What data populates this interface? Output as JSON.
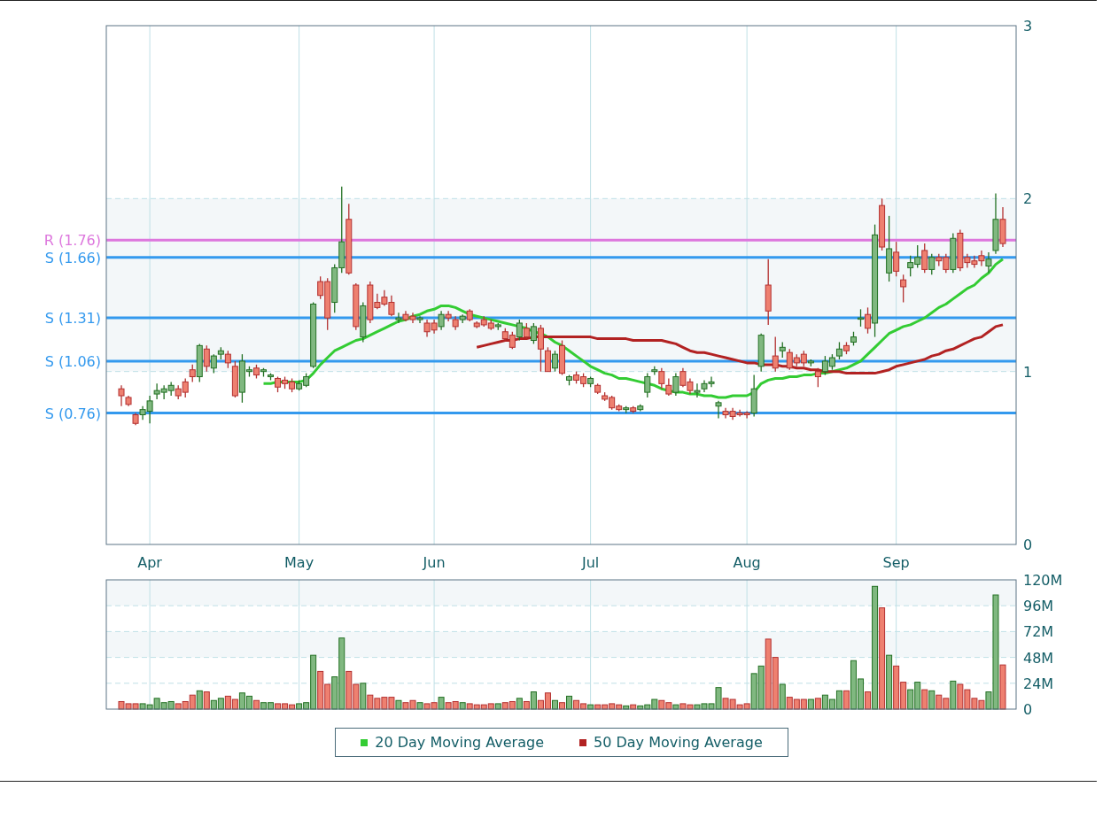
{
  "price_chart": {
    "chart_data": {
      "type": "candlestick",
      "ylim": [
        0,
        3
      ],
      "yticks": [
        0,
        1,
        2,
        3
      ],
      "grid": true,
      "categories": [
        null,
        null,
        null,
        null,
        "Apr",
        null,
        null,
        null,
        null,
        null,
        null,
        null,
        null,
        null,
        null,
        null,
        null,
        null,
        null,
        null,
        null,
        null,
        null,
        null,
        null,
        "May",
        null,
        null,
        null,
        null,
        null,
        null,
        null,
        null,
        null,
        null,
        null,
        null,
        null,
        null,
        null,
        null,
        null,
        null,
        "Jun",
        null,
        null,
        null,
        null,
        null,
        null,
        null,
        null,
        null,
        null,
        null,
        null,
        null,
        null,
        null,
        null,
        null,
        null,
        null,
        null,
        null,
        "Jul",
        null,
        null,
        null,
        null,
        null,
        null,
        null,
        null,
        null,
        null,
        null,
        null,
        null,
        null,
        null,
        null,
        null,
        null,
        null,
        null,
        null,
        "Aug",
        null,
        null,
        null,
        null,
        null,
        null,
        null,
        null,
        null,
        null,
        null,
        null,
        null,
        null,
        null,
        null,
        null,
        null,
        null,
        null,
        "Sep",
        null,
        null,
        null,
        null,
        null,
        null,
        null,
        null,
        null,
        null,
        null,
        null,
        null,
        null,
        null
      ],
      "ohlc": [
        [
          0.9,
          0.92,
          0.8,
          0.86
        ],
        [
          0.85,
          0.86,
          0.8,
          0.81
        ],
        [
          0.75,
          0.76,
          0.69,
          0.7
        ],
        [
          0.75,
          0.8,
          0.72,
          0.78
        ],
        [
          0.77,
          0.86,
          0.7,
          0.83
        ],
        [
          0.87,
          0.93,
          0.84,
          0.89
        ],
        [
          0.88,
          0.92,
          0.84,
          0.9
        ],
        [
          0.89,
          0.94,
          0.86,
          0.92
        ],
        [
          0.9,
          0.92,
          0.84,
          0.86
        ],
        [
          0.94,
          0.96,
          0.85,
          0.88
        ],
        [
          1.01,
          1.04,
          0.94,
          0.97
        ],
        [
          0.97,
          1.16,
          0.94,
          1.15
        ],
        [
          1.13,
          1.15,
          1.0,
          1.03
        ],
        [
          1.02,
          1.1,
          0.99,
          1.09
        ],
        [
          1.1,
          1.14,
          1.07,
          1.12
        ],
        [
          1.1,
          1.12,
          1.02,
          1.05
        ],
        [
          1.03,
          1.06,
          0.85,
          0.86
        ],
        [
          0.88,
          1.1,
          0.82,
          1.06
        ],
        [
          1.0,
          1.03,
          0.97,
          1.01
        ],
        [
          1.02,
          1.04,
          0.96,
          0.98
        ],
        [
          1.0,
          1.02,
          0.97,
          1.01
        ],
        [
          0.97,
          0.99,
          0.95,
          0.98
        ],
        [
          0.96,
          0.97,
          0.88,
          0.91
        ],
        [
          0.95,
          0.97,
          0.9,
          0.93
        ],
        [
          0.94,
          0.96,
          0.88,
          0.9
        ],
        [
          0.9,
          0.95,
          0.89,
          0.93
        ],
        [
          0.92,
          0.99,
          0.91,
          0.97
        ],
        [
          1.03,
          1.4,
          1.02,
          1.39
        ],
        [
          1.52,
          1.55,
          1.42,
          1.44
        ],
        [
          1.52,
          1.54,
          1.24,
          1.31
        ],
        [
          1.4,
          1.62,
          1.34,
          1.6
        ],
        [
          1.6,
          2.07,
          1.57,
          1.75
        ],
        [
          1.88,
          1.97,
          1.56,
          1.57
        ],
        [
          1.5,
          1.51,
          1.24,
          1.26
        ],
        [
          1.2,
          1.4,
          1.17,
          1.38
        ],
        [
          1.5,
          1.52,
          1.28,
          1.3
        ],
        [
          1.4,
          1.45,
          1.36,
          1.37
        ],
        [
          1.43,
          1.47,
          1.38,
          1.39
        ],
        [
          1.4,
          1.44,
          1.32,
          1.33
        ],
        [
          1.3,
          1.34,
          1.28,
          1.31
        ],
        [
          1.33,
          1.35,
          1.29,
          1.3
        ],
        [
          1.32,
          1.34,
          1.28,
          1.3
        ],
        [
          1.3,
          1.32,
          1.28,
          1.31
        ],
        [
          1.28,
          1.3,
          1.2,
          1.23
        ],
        [
          1.28,
          1.3,
          1.22,
          1.24
        ],
        [
          1.26,
          1.35,
          1.24,
          1.33
        ],
        [
          1.33,
          1.35,
          1.29,
          1.31
        ],
        [
          1.3,
          1.32,
          1.24,
          1.26
        ],
        [
          1.3,
          1.33,
          1.28,
          1.32
        ],
        [
          1.35,
          1.36,
          1.29,
          1.3
        ],
        [
          1.28,
          1.29,
          1.25,
          1.26
        ],
        [
          1.3,
          1.32,
          1.26,
          1.27
        ],
        [
          1.28,
          1.3,
          1.24,
          1.25
        ],
        [
          1.26,
          1.28,
          1.24,
          1.27
        ],
        [
          1.23,
          1.25,
          1.18,
          1.19
        ],
        [
          1.21,
          1.23,
          1.13,
          1.14
        ],
        [
          1.2,
          1.3,
          1.18,
          1.28
        ],
        [
          1.25,
          1.28,
          1.19,
          1.2
        ],
        [
          1.18,
          1.28,
          1.16,
          1.26
        ],
        [
          1.25,
          1.27,
          1.0,
          1.13
        ],
        [
          1.12,
          1.14,
          1.0,
          1.0
        ],
        [
          1.02,
          1.12,
          1.0,
          1.1
        ],
        [
          1.15,
          1.18,
          0.98,
          0.99
        ],
        [
          0.95,
          0.98,
          0.92,
          0.97
        ],
        [
          0.98,
          1.0,
          0.93,
          0.95
        ],
        [
          0.97,
          0.99,
          0.91,
          0.93
        ],
        [
          0.93,
          0.97,
          0.91,
          0.96
        ],
        [
          0.92,
          0.93,
          0.87,
          0.88
        ],
        [
          0.86,
          0.88,
          0.83,
          0.84
        ],
        [
          0.85,
          0.86,
          0.78,
          0.79
        ],
        [
          0.8,
          0.81,
          0.77,
          0.78
        ],
        [
          0.78,
          0.8,
          0.76,
          0.79
        ],
        [
          0.79,
          0.8,
          0.76,
          0.77
        ],
        [
          0.78,
          0.81,
          0.77,
          0.8
        ],
        [
          0.88,
          0.99,
          0.85,
          0.97
        ],
        [
          1.0,
          1.03,
          0.98,
          1.01
        ],
        [
          1.0,
          1.02,
          0.9,
          0.93
        ],
        [
          0.92,
          0.96,
          0.86,
          0.87
        ],
        [
          0.88,
          0.99,
          0.86,
          0.97
        ],
        [
          1.0,
          1.02,
          0.91,
          0.92
        ],
        [
          0.94,
          0.96,
          0.87,
          0.89
        ],
        [
          0.88,
          0.93,
          0.85,
          0.89
        ],
        [
          0.9,
          0.95,
          0.88,
          0.93
        ],
        [
          0.93,
          0.97,
          0.91,
          0.94
        ],
        [
          0.8,
          0.83,
          0.73,
          0.82
        ],
        [
          0.77,
          0.79,
          0.73,
          0.75
        ],
        [
          0.77,
          0.79,
          0.72,
          0.74
        ],
        [
          0.76,
          0.78,
          0.74,
          0.75
        ],
        [
          0.76,
          0.77,
          0.73,
          0.75
        ],
        [
          0.76,
          0.98,
          0.74,
          0.9
        ],
        [
          1.03,
          1.22,
          1.0,
          1.21
        ],
        [
          1.5,
          1.65,
          1.27,
          1.35
        ],
        [
          1.09,
          1.2,
          1.0,
          1.02
        ],
        [
          1.12,
          1.17,
          1.08,
          1.14
        ],
        [
          1.11,
          1.13,
          1.01,
          1.02
        ],
        [
          1.08,
          1.1,
          1.03,
          1.05
        ],
        [
          1.1,
          1.12,
          1.03,
          1.05
        ],
        [
          1.05,
          1.07,
          1.03,
          1.06
        ],
        [
          1.0,
          1.02,
          0.91,
          0.97
        ],
        [
          1.0,
          1.09,
          0.98,
          1.06
        ],
        [
          1.03,
          1.1,
          1.01,
          1.08
        ],
        [
          1.09,
          1.17,
          1.07,
          1.13
        ],
        [
          1.15,
          1.17,
          1.1,
          1.12
        ],
        [
          1.17,
          1.23,
          1.15,
          1.2
        ],
        [
          1.31,
          1.36,
          1.26,
          1.31
        ],
        [
          1.33,
          1.37,
          1.22,
          1.25
        ],
        [
          1.28,
          1.85,
          1.2,
          1.79
        ],
        [
          1.96,
          2.0,
          1.7,
          1.72
        ],
        [
          1.57,
          1.9,
          1.52,
          1.71
        ],
        [
          1.69,
          1.75,
          1.55,
          1.58
        ],
        [
          1.53,
          1.56,
          1.4,
          1.49
        ],
        [
          1.6,
          1.67,
          1.55,
          1.63
        ],
        [
          1.62,
          1.73,
          1.6,
          1.66
        ],
        [
          1.7,
          1.74,
          1.57,
          1.59
        ],
        [
          1.59,
          1.68,
          1.56,
          1.66
        ],
        [
          1.66,
          1.68,
          1.61,
          1.64
        ],
        [
          1.66,
          1.68,
          1.57,
          1.59
        ],
        [
          1.59,
          1.8,
          1.57,
          1.77
        ],
        [
          1.8,
          1.82,
          1.58,
          1.6
        ],
        [
          1.66,
          1.68,
          1.6,
          1.63
        ],
        [
          1.64,
          1.67,
          1.6,
          1.62
        ],
        [
          1.67,
          1.7,
          1.61,
          1.64
        ],
        [
          1.61,
          1.69,
          1.57,
          1.65
        ],
        [
          1.7,
          2.03,
          1.68,
          1.88
        ],
        [
          1.88,
          1.95,
          1.72,
          1.74
        ]
      ],
      "series": [
        {
          "name": "20 Day Moving Average",
          "type": "line",
          "color": "#33cc33",
          "values": [
            null,
            null,
            null,
            null,
            null,
            null,
            null,
            null,
            null,
            null,
            null,
            null,
            null,
            null,
            null,
            null,
            null,
            null,
            null,
            null,
            0.93,
            0.93,
            0.94,
            0.94,
            0.94,
            0.94,
            0.95,
            0.99,
            1.04,
            1.08,
            1.12,
            1.14,
            1.16,
            1.18,
            1.19,
            1.21,
            1.23,
            1.25,
            1.27,
            1.29,
            1.3,
            1.32,
            1.33,
            1.35,
            1.36,
            1.38,
            1.38,
            1.37,
            1.35,
            1.33,
            1.32,
            1.31,
            1.3,
            1.29,
            1.28,
            1.27,
            1.26,
            1.25,
            1.23,
            1.22,
            1.2,
            1.17,
            1.15,
            1.12,
            1.09,
            1.06,
            1.03,
            1.01,
            0.99,
            0.98,
            0.96,
            0.96,
            0.95,
            0.94,
            0.93,
            0.92,
            0.9,
            0.89,
            0.88,
            0.88,
            0.87,
            0.87,
            0.86,
            0.86,
            0.85,
            0.85,
            0.86,
            0.86,
            0.86,
            0.88,
            0.93,
            0.95,
            0.96,
            0.96,
            0.97,
            0.97,
            0.98,
            0.98,
            0.99,
            0.99,
            1.0,
            1.01,
            1.02,
            1.04,
            1.06,
            1.1,
            1.14,
            1.18,
            1.22,
            1.24,
            1.26,
            1.27,
            1.29,
            1.31,
            1.34,
            1.37,
            1.39,
            1.42,
            1.45,
            1.48,
            1.5,
            1.54,
            1.57,
            1.62,
            1.65
          ]
        },
        {
          "name": "50 Day Moving Average",
          "type": "line",
          "color": "#b22222",
          "values": [
            null,
            null,
            null,
            null,
            null,
            null,
            null,
            null,
            null,
            null,
            null,
            null,
            null,
            null,
            null,
            null,
            null,
            null,
            null,
            null,
            null,
            null,
            null,
            null,
            null,
            null,
            null,
            null,
            null,
            null,
            null,
            null,
            null,
            null,
            null,
            null,
            null,
            null,
            null,
            null,
            null,
            null,
            null,
            null,
            null,
            null,
            null,
            null,
            null,
            null,
            1.14,
            1.15,
            1.16,
            1.17,
            1.18,
            1.18,
            1.19,
            1.19,
            1.2,
            1.2,
            1.2,
            1.2,
            1.2,
            1.2,
            1.2,
            1.2,
            1.2,
            1.19,
            1.19,
            1.19,
            1.19,
            1.19,
            1.18,
            1.18,
            1.18,
            1.18,
            1.18,
            1.17,
            1.16,
            1.14,
            1.12,
            1.11,
            1.11,
            1.1,
            1.09,
            1.08,
            1.07,
            1.06,
            1.05,
            1.05,
            1.04,
            1.04,
            1.04,
            1.03,
            1.03,
            1.02,
            1.02,
            1.01,
            1.01,
            1.0,
            1.0,
            1.0,
            0.99,
            0.99,
            0.99,
            0.99,
            0.99,
            1.0,
            1.01,
            1.03,
            1.04,
            1.05,
            1.06,
            1.07,
            1.09,
            1.1,
            1.12,
            1.13,
            1.15,
            1.17,
            1.19,
            1.2,
            1.23,
            1.26,
            1.27
          ]
        }
      ],
      "bands": [
        {
          "axis": "y",
          "from": 1,
          "to": 2
        }
      ],
      "ref_lines": [
        {
          "axis": "y",
          "value": 1.76,
          "label": "R (1.76)",
          "color": "#dd77dd"
        },
        {
          "axis": "y",
          "value": 1.66,
          "label": "S (1.66)",
          "color": "#3399ee"
        },
        {
          "axis": "y",
          "value": 1.31,
          "label": "S (1.31)",
          "color": "#3399ee"
        },
        {
          "axis": "y",
          "value": 1.06,
          "label": "S (1.06)",
          "color": "#3399ee"
        },
        {
          "axis": "y",
          "value": 0.76,
          "label": "S (0.76)",
          "color": "#3399ee"
        }
      ]
    }
  },
  "volume_chart": {
    "chart_data": {
      "type": "bar",
      "ylim": [
        0,
        120
      ],
      "grid": true,
      "stacked": true,
      "yticks": [
        {
          "value": 0,
          "label": "0"
        },
        {
          "value": 24,
          "label": "24M"
        },
        {
          "value": 48,
          "label": "48M"
        },
        {
          "value": 72,
          "label": "72M"
        },
        {
          "value": 96,
          "label": "96M"
        },
        {
          "value": 120,
          "label": "120M"
        }
      ],
      "series": [
        {
          "color": "#80b880",
          "values": [
            null,
            null,
            null,
            5,
            4,
            10,
            6,
            7,
            null,
            null,
            null,
            17,
            null,
            8,
            10,
            null,
            null,
            15,
            12,
            null,
            6,
            6,
            null,
            null,
            null,
            5,
            6,
            50,
            null,
            null,
            30,
            66,
            null,
            null,
            24,
            null,
            null,
            null,
            null,
            8,
            null,
            null,
            6,
            null,
            null,
            11,
            null,
            null,
            6,
            null,
            null,
            null,
            null,
            5,
            null,
            null,
            10,
            null,
            16,
            null,
            null,
            8,
            null,
            12,
            null,
            null,
            4,
            null,
            null,
            null,
            null,
            3,
            null,
            3,
            4,
            9,
            null,
            null,
            4,
            null,
            null,
            4,
            5,
            5,
            20,
            null,
            null,
            null,
            null,
            33,
            40,
            null,
            null,
            23,
            null,
            null,
            null,
            9,
            null,
            13,
            9,
            17,
            null,
            45,
            28,
            null,
            114,
            null,
            50,
            null,
            null,
            18,
            25,
            null,
            17,
            null,
            null,
            26,
            null,
            null,
            null,
            null,
            16,
            106,
            null
          ]
        },
        {
          "color": "#ee8070",
          "values": [
            7,
            5,
            5,
            null,
            null,
            null,
            null,
            null,
            5,
            7,
            13,
            null,
            16,
            null,
            null,
            12,
            9,
            null,
            null,
            8,
            null,
            null,
            5,
            5,
            4,
            null,
            null,
            null,
            35,
            23,
            null,
            null,
            35,
            23,
            null,
            13,
            10,
            11,
            11,
            null,
            6,
            8,
            null,
            5,
            6,
            null,
            6,
            7,
            null,
            5,
            4,
            4,
            5,
            null,
            6,
            7,
            null,
            7,
            null,
            8,
            15,
            null,
            6,
            null,
            8,
            5,
            null,
            4,
            4,
            5,
            4,
            null,
            4,
            null,
            null,
            null,
            8,
            6,
            null,
            5,
            4,
            null,
            null,
            null,
            null,
            10,
            9,
            4,
            5,
            null,
            null,
            65,
            48,
            null,
            11,
            9,
            9,
            null,
            10,
            null,
            null,
            null,
            17,
            null,
            null,
            16,
            null,
            94,
            null,
            40,
            25,
            null,
            null,
            18,
            null,
            13,
            10,
            null,
            23,
            18,
            10,
            8,
            null,
            null,
            41
          ]
        }
      ]
    }
  }
}
